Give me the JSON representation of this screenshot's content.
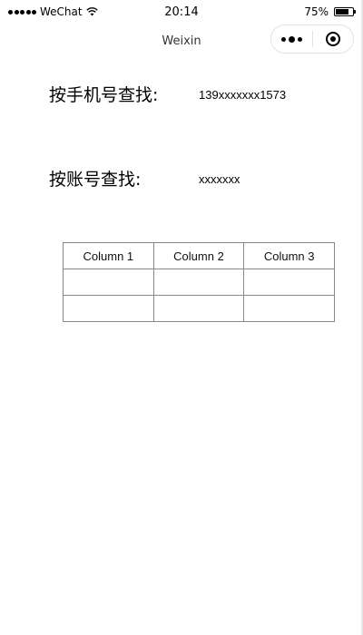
{
  "status_bar": {
    "carrier": "WeChat",
    "time": "20:14",
    "battery_percent_text": "75%",
    "battery_level": 0.75
  },
  "nav": {
    "title": "Weixin"
  },
  "search": {
    "phone_label": "按手机号查找:",
    "phone_value": "139xxxxxxx1573",
    "account_label": "按账号查找:",
    "account_value": "xxxxxxx"
  },
  "table": {
    "headers": [
      "Column 1",
      "Column 2",
      "Column 3"
    ],
    "rows": [
      [
        "",
        "",
        ""
      ],
      [
        "",
        "",
        ""
      ]
    ]
  }
}
